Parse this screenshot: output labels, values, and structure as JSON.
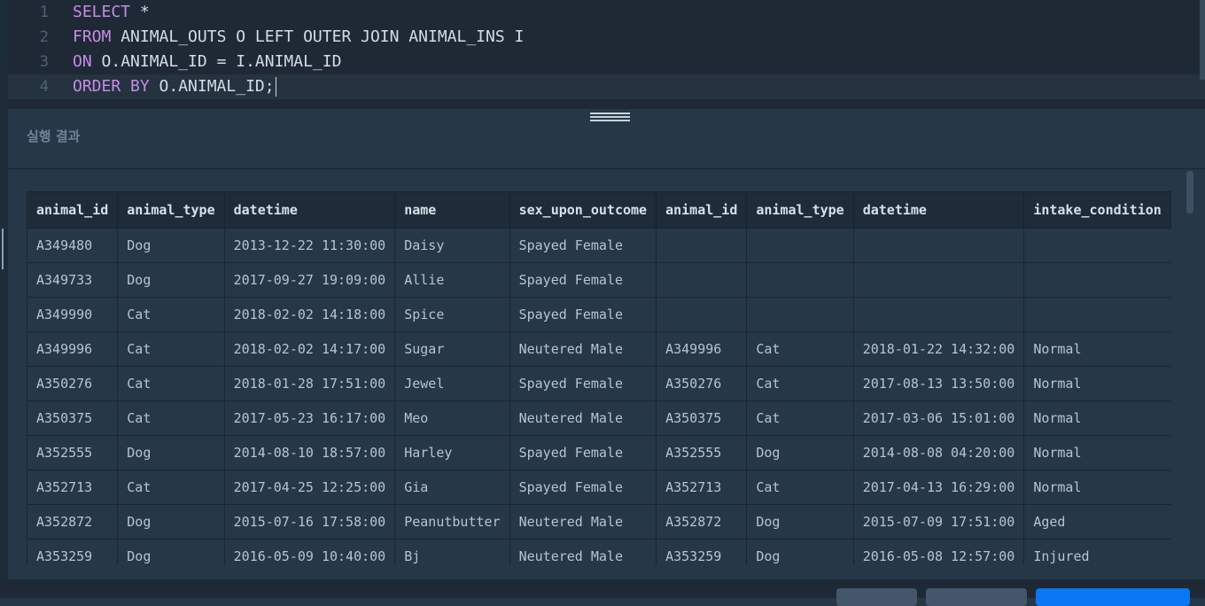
{
  "editor": {
    "lines": [
      {
        "num": "1",
        "kw": "SELECT",
        "rest": " *"
      },
      {
        "num": "2",
        "kw": "FROM",
        "rest": " ANIMAL_OUTS O LEFT OUTER JOIN ANIMAL_INS I"
      },
      {
        "num": "3",
        "kw": "ON",
        "rest": " O.ANIMAL_ID = I.ANIMAL_ID"
      },
      {
        "num": "4",
        "kw": "ORDER BY",
        "rest": " O.ANIMAL_ID;"
      }
    ]
  },
  "results": {
    "title": "실행 결과",
    "columns": [
      "animal_id",
      "animal_type",
      "datetime",
      "name",
      "sex_upon_outcome",
      "animal_id",
      "animal_type",
      "datetime",
      "intake_condition"
    ],
    "rows": [
      [
        "A349480",
        "Dog",
        "2013-12-22 11:30:00",
        "Daisy",
        "Spayed Female",
        "",
        "",
        "",
        ""
      ],
      [
        "A349733",
        "Dog",
        "2017-09-27 19:09:00",
        "Allie",
        "Spayed Female",
        "",
        "",
        "",
        ""
      ],
      [
        "A349990",
        "Cat",
        "2018-02-02 14:18:00",
        "Spice",
        "Spayed Female",
        "",
        "",
        "",
        ""
      ],
      [
        "A349996",
        "Cat",
        "2018-02-02 14:17:00",
        "Sugar",
        "Neutered Male",
        "A349996",
        "Cat",
        "2018-01-22 14:32:00",
        "Normal"
      ],
      [
        "A350276",
        "Cat",
        "2018-01-28 17:51:00",
        "Jewel",
        "Spayed Female",
        "A350276",
        "Cat",
        "2017-08-13 13:50:00",
        "Normal"
      ],
      [
        "A350375",
        "Cat",
        "2017-05-23 16:17:00",
        "Meo",
        "Neutered Male",
        "A350375",
        "Cat",
        "2017-03-06 15:01:00",
        "Normal"
      ],
      [
        "A352555",
        "Dog",
        "2014-08-10 18:57:00",
        "Harley",
        "Spayed Female",
        "A352555",
        "Dog",
        "2014-08-08 04:20:00",
        "Normal"
      ],
      [
        "A352713",
        "Cat",
        "2017-04-25 12:25:00",
        "Gia",
        "Spayed Female",
        "A352713",
        "Cat",
        "2017-04-13 16:29:00",
        "Normal"
      ],
      [
        "A352872",
        "Dog",
        "2015-07-16 17:58:00",
        "Peanutbutter",
        "Neutered Male",
        "A352872",
        "Dog",
        "2015-07-09 17:51:00",
        "Aged"
      ],
      [
        "A353259",
        "Dog",
        "2016-05-09 10:40:00",
        "Bj",
        "Neutered Male",
        "A353259",
        "Dog",
        "2016-05-08 12:57:00",
        "Injured"
      ]
    ]
  },
  "colors": {
    "keyword": "#c58ce6",
    "primary_button": "#0a78f0"
  }
}
